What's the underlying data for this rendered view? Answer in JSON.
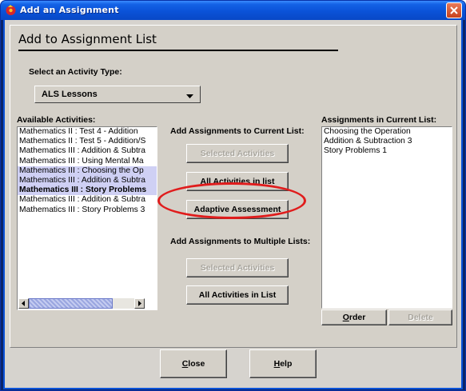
{
  "window": {
    "title": "Add an Assignment",
    "accent": "#0a52d8",
    "title_icon": "app-icon",
    "close_icon": "close-icon"
  },
  "heading": "Add to Assignment List",
  "activity_type": {
    "label": "Select an Activity Type:",
    "selected": "ALS Lessons"
  },
  "available": {
    "label": "Available Activities:",
    "items": [
      "Mathematics II : Test 4 - Addition",
      "Mathematics II : Test 5 - Addition/S",
      "Mathematics III : Addition & Subtra",
      "Mathematics III : Using Mental Ma",
      "Mathematics III : Choosing the Op",
      "Mathematics III : Addition & Subtra",
      "Mathematics III : Story Problems",
      "Mathematics III : Addition & Subtra",
      "Mathematics III : Story Problems 3"
    ]
  },
  "current_list_section": {
    "label": "Add Assignments to Current List:",
    "selected_btn": "Selected Activities",
    "all_btn": "All Activities in list",
    "adaptive_btn": "Adaptive Assessment"
  },
  "multiple_list_section": {
    "label": "Add Assignments to Multiple Lists:",
    "selected_btn": "Selected Activities",
    "all_btn": "All Activities in List"
  },
  "assignments": {
    "label": "Assignments in Current List:",
    "items": [
      "Choosing the Operation",
      "Addition & Subtraction 3",
      "Story Problems 1"
    ],
    "order_btn_first": "O",
    "order_btn_rest": "rder",
    "delete_btn": "Delete"
  },
  "footer": {
    "close_first": "C",
    "close_rest": "lose",
    "help_first": "H",
    "help_rest": "elp"
  },
  "highlight_color": "#e01c1c"
}
